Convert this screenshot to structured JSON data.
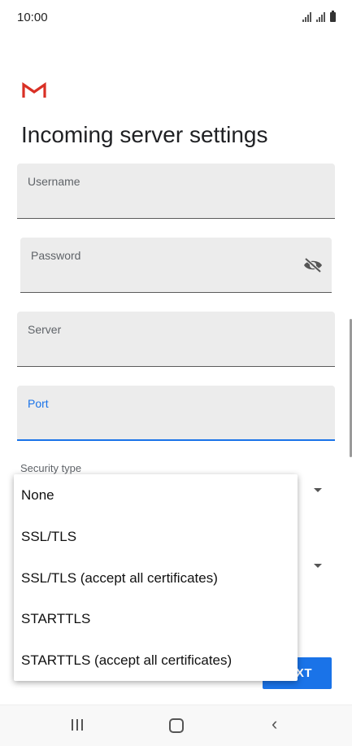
{
  "status_bar": {
    "time": "10:00"
  },
  "page": {
    "title": "Incoming server settings"
  },
  "fields": {
    "username": {
      "label": "Username"
    },
    "password": {
      "label": "Password"
    },
    "server": {
      "label": "Server"
    },
    "port": {
      "label": "Port"
    }
  },
  "security": {
    "label": "Security type",
    "options": [
      "None",
      "SSL/TLS",
      "SSL/TLS (accept all certificates)",
      "STARTTLS",
      "STARTTLS (accept all certificates)"
    ]
  },
  "buttons": {
    "next_label": "XT"
  },
  "icons": {
    "logo": "gmail-icon",
    "password_toggle": "eye-off-icon",
    "nav_recent": "recent-apps-icon",
    "nav_home": "home-icon",
    "nav_back": "back-icon"
  },
  "colors": {
    "accent": "#1a73e8",
    "gmail_red": "#d93025"
  }
}
